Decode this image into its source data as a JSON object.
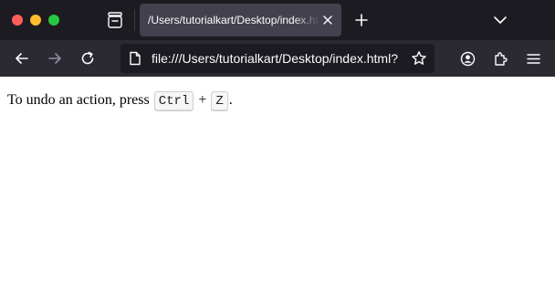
{
  "browser": {
    "tab": {
      "title": "/Users/tutorialkart/Desktop/index.html"
    },
    "urlbar": {
      "url": "file:///Users/tutorialkart/Desktop/index.html?"
    }
  },
  "page": {
    "text_before": "To undo an action, press ",
    "key1": "Ctrl",
    "plus": " + ",
    "key2": "Z",
    "text_after": "."
  }
}
